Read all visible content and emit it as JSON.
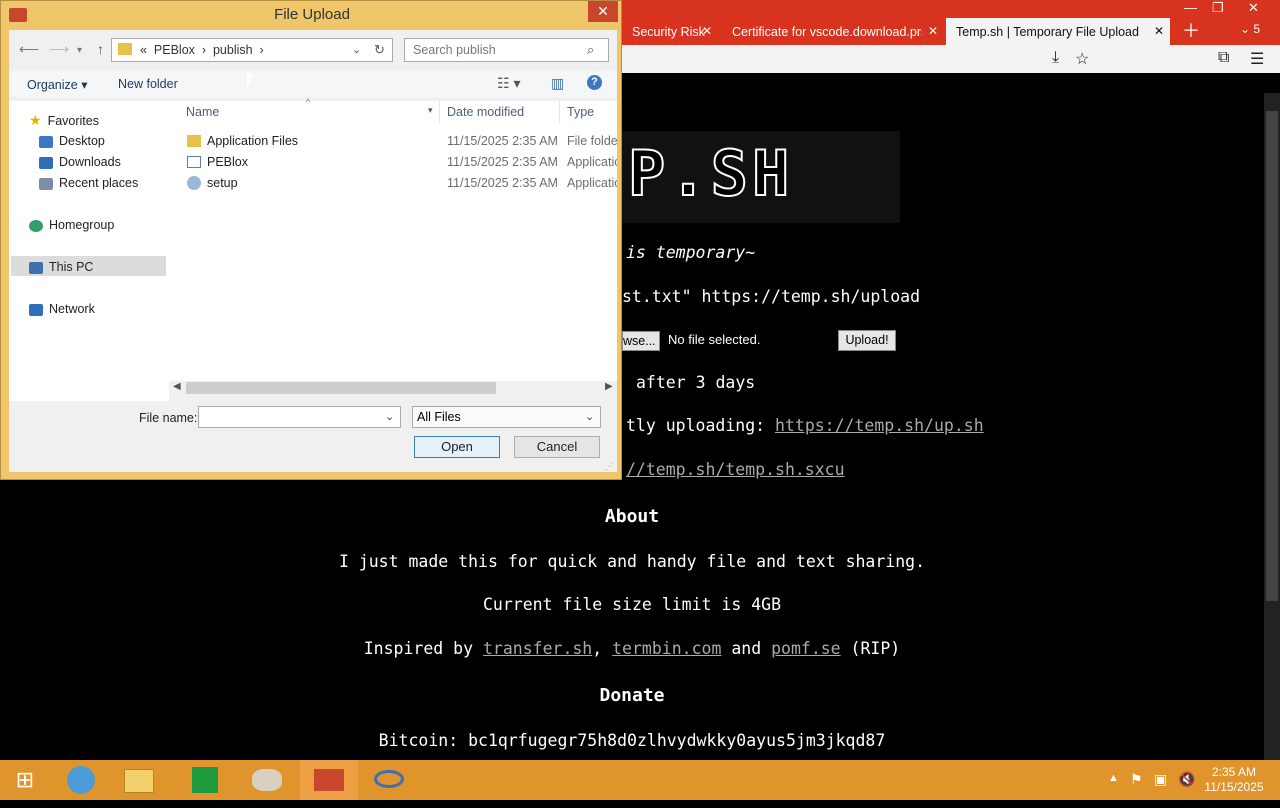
{
  "browser": {
    "tabs": [
      {
        "label": "Security Risk"
      },
      {
        "label": "Certificate for vscode.download.prsi"
      },
      {
        "label": "Temp.sh | Temporary File Upload",
        "active": true
      }
    ],
    "tab_count_badge": "5"
  },
  "page": {
    "logo_text": "P.SH",
    "tagline": "is temporary~",
    "curl_text": "st.txt\" https://temp.sh/upload",
    "browse_label": "wse...",
    "no_file": "No file selected.",
    "upload_label": "Upload!",
    "expire_text": "after 3 days",
    "script_text": "tly uploading: ",
    "script_link": "https://temp.sh/up.sh",
    "sxcu_link": "//temp.sh/temp.sh.sxcu",
    "about_heading": "About",
    "about_line": "I just made this for quick and handy file and text sharing.",
    "limit_line": "Current file size limit is 4GB",
    "inspired_prefix": "Inspired by ",
    "link_transfer": "transfer.sh",
    "comma": ",",
    "link_termbin": "termbin.com",
    "and_text": " and ",
    "link_pomf": "pomf.se",
    "rip_text": " (RIP)",
    "donate_heading": "Donate",
    "bitcoin_line": "Bitcoin: bc1qrfugegr75h8d0zlhvydwkky0ayus5jm3jkqd87"
  },
  "dialog": {
    "title": "File Upload",
    "breadcrumb": [
      "«",
      "PEBlox",
      "publish"
    ],
    "search_placeholder": "Search publish",
    "organize_label": "Organize",
    "new_folder_label": "New folder",
    "nav": {
      "favorites": "Favorites",
      "desktop": "Desktop",
      "downloads": "Downloads",
      "recent": "Recent places",
      "homegroup": "Homegroup",
      "this_pc": "This PC",
      "network": "Network"
    },
    "columns": {
      "name": "Name",
      "date": "Date modified",
      "type": "Type"
    },
    "files": [
      {
        "name": "Application Files",
        "date": "11/15/2025 2:35 AM",
        "type": "File folder"
      },
      {
        "name": "PEBlox",
        "date": "11/15/2025 2:35 AM",
        "type": "Application"
      },
      {
        "name": "setup",
        "date": "11/15/2025 2:35 AM",
        "type": "Application"
      }
    ],
    "filename_label": "File name:",
    "filename_value": "",
    "filter_value": "All Files",
    "open_label": "Open",
    "cancel_label": "Cancel"
  },
  "taskbar": {
    "time": "2:35 AM",
    "date": "11/15/2025"
  },
  "colors": {
    "tab_strip": "#d7331f",
    "dialog_frame": "#f0c66b",
    "taskbar": "#e0942c"
  }
}
